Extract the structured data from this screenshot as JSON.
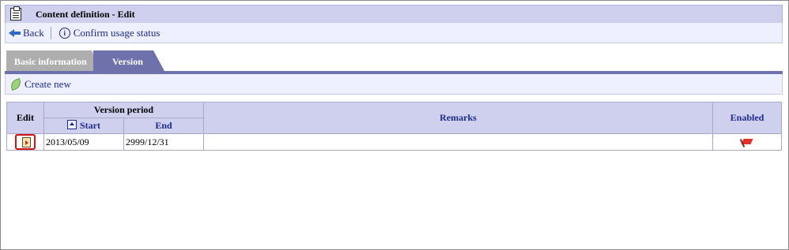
{
  "window": {
    "title": "Content definition - Edit"
  },
  "toolbar": {
    "back_label": "Back",
    "confirm_label": "Confirm usage status"
  },
  "tabs": [
    {
      "label": "Basic information",
      "active": false
    },
    {
      "label": "Version",
      "active": true
    }
  ],
  "subbar": {
    "create_new_label": "Create new"
  },
  "table": {
    "headers": {
      "edit": "Edit",
      "version_period": "Version period",
      "start": "Start",
      "end": "End",
      "remarks": "Remarks",
      "enabled": "Enabled"
    },
    "rows": [
      {
        "start": "2013/05/09",
        "end": "2999/12/31",
        "remarks": "",
        "enabled_icon": "red-flag-icon"
      }
    ]
  },
  "colors": {
    "title_bg": "#cfd0ee",
    "active_tab": "#6f71ad",
    "inactive_tab": "#aeaeae",
    "link": "#1d2a8c",
    "highlight": "#d21414"
  }
}
